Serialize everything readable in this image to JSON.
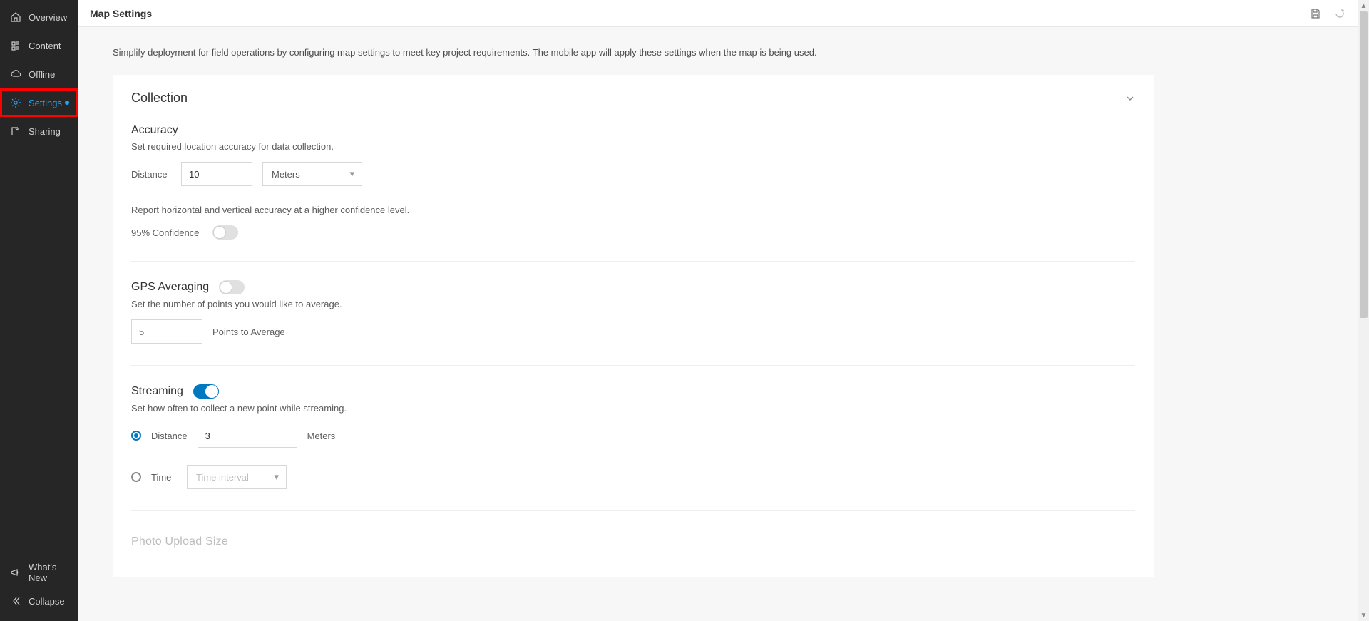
{
  "sidebar": {
    "items": [
      {
        "label": "Overview"
      },
      {
        "label": "Content"
      },
      {
        "label": "Offline"
      },
      {
        "label": "Settings",
        "active": true,
        "indicator": true,
        "highlight": true
      },
      {
        "label": "Sharing"
      }
    ],
    "footer": [
      {
        "label": "What's New"
      },
      {
        "label": "Collapse"
      }
    ]
  },
  "header": {
    "title": "Map Settings"
  },
  "intro": "Simplify deployment for field operations by configuring map settings to meet key project requirements. The mobile app will apply these settings when the map is being used.",
  "collection": {
    "title": "Collection",
    "accuracy": {
      "title": "Accuracy",
      "desc": "Set required location accuracy for data collection.",
      "distance_label": "Distance",
      "distance_value": "10",
      "unit_selected": "Meters",
      "confidence_desc": "Report horizontal and vertical accuracy at a higher confidence level.",
      "confidence_label": "95% Confidence",
      "confidence_on": false
    },
    "gps": {
      "title": "GPS Averaging",
      "on": false,
      "desc": "Set the number of points you would like to average.",
      "points_placeholder": "5",
      "points_label": "Points to Average"
    },
    "streaming": {
      "title": "Streaming",
      "on": true,
      "desc": "Set how often to collect a new point while streaming.",
      "mode_distance_label": "Distance",
      "mode_time_label": "Time",
      "distance_value": "3",
      "distance_unit": "Meters",
      "time_placeholder": "Time interval",
      "selected_mode": "distance"
    },
    "photo": {
      "title": "Photo Upload Size"
    }
  }
}
